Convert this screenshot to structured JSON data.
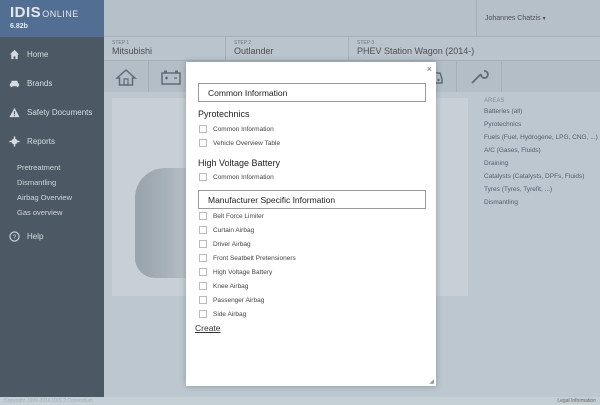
{
  "brand": {
    "name": "IDIS",
    "suffix": "ONLINE",
    "version": "6.82b"
  },
  "nav": {
    "home": "Home",
    "brands": "Brands",
    "safety": "Safety Documents",
    "reports": "Reports",
    "reports_sub": [
      "Pretreatment",
      "Dismantling",
      "Airbag Overview",
      "Gas overview"
    ],
    "help": "Help"
  },
  "user": {
    "name": "Johannes Chatzis"
  },
  "steps": [
    {
      "label": "STEP 1",
      "value": "Mitsubishi"
    },
    {
      "label": "STEP 2",
      "value": "Outlander"
    },
    {
      "label": "STEP 3",
      "value": "PHEV Station Wagon (2014-)"
    }
  ],
  "areas": {
    "heading": "AREAS",
    "items": [
      "Batteries (all)",
      "Pyrotechnics",
      "Fuels (Fuel, Hydrogene, LPG, CNG, ...)",
      "A/C (Gases, Fluids)",
      "Draining",
      "Catalysts (Catalysts, DPFs, Fluids)",
      "Tyres (Tyres, Tyrefit, ...)",
      "Dismantling"
    ]
  },
  "modal": {
    "close": "×",
    "common_header": "Common Information",
    "pyro_title": "Pyrotechnics",
    "pyro_options": [
      "Common Information",
      "Vehicle Overview Table"
    ],
    "hv_title": "High Voltage Battery",
    "hv_options": [
      "Common Information"
    ],
    "manu_header": "Manufacturer Specific Information",
    "manu_options": [
      "Belt Force Limiter",
      "Curtain Airbag",
      "Driver Airbag",
      "Front Seatbelt Pretensioners",
      "High Voltage Battery",
      "Knee Airbag",
      "Passenger Airbag",
      "Side Airbag"
    ],
    "create": "Create"
  },
  "footer": {
    "copyright": "Copyright 1999-2016 IDIS 2 Consortium",
    "legal": "Legal Information"
  }
}
